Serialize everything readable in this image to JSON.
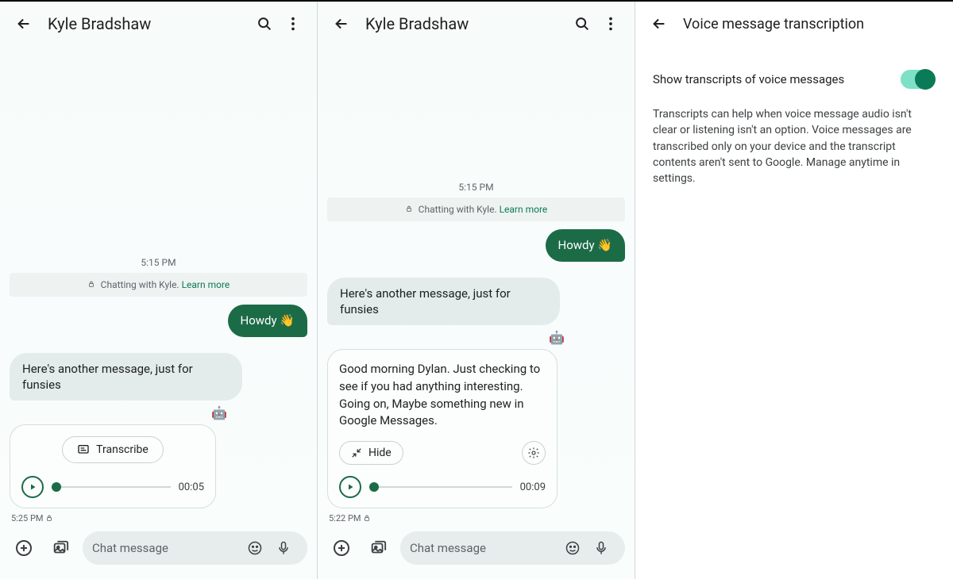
{
  "pane1": {
    "title": "Kyle Bradshaw",
    "timestamp": "5:15 PM",
    "banner_prefix": "Chatting with Kyle. ",
    "banner_link": "Learn more",
    "out_msg": "Howdy 👋",
    "in_msg": "Here's another message, just for funsies",
    "transcribe_label": "Transcribe",
    "duration": "00:05",
    "meta": "5:25 PM",
    "placeholder": "Chat message"
  },
  "pane2": {
    "title": "Kyle Bradshaw",
    "timestamp": "5:15 PM",
    "banner_prefix": "Chatting with Kyle. ",
    "banner_link": "Learn more",
    "out_msg": "Howdy 👋",
    "in_msg": "Here's another message, just for funsies",
    "transcript": "Good morning Dylan. Just checking to see if you had anything interesting. Going on, Maybe something new in Google Messages.",
    "hide_label": "Hide",
    "duration": "00:09",
    "meta": "5:22 PM",
    "placeholder": "Chat message"
  },
  "pane3": {
    "title": "Voice message transcription",
    "toggle_label": "Show transcripts of voice messages",
    "description": "Transcripts can help when voice message audio isn't clear or listening isn't an option. Voice messages are transcribed only on your device and the transcript contents aren't sent to Google. Manage anytime in settings."
  }
}
